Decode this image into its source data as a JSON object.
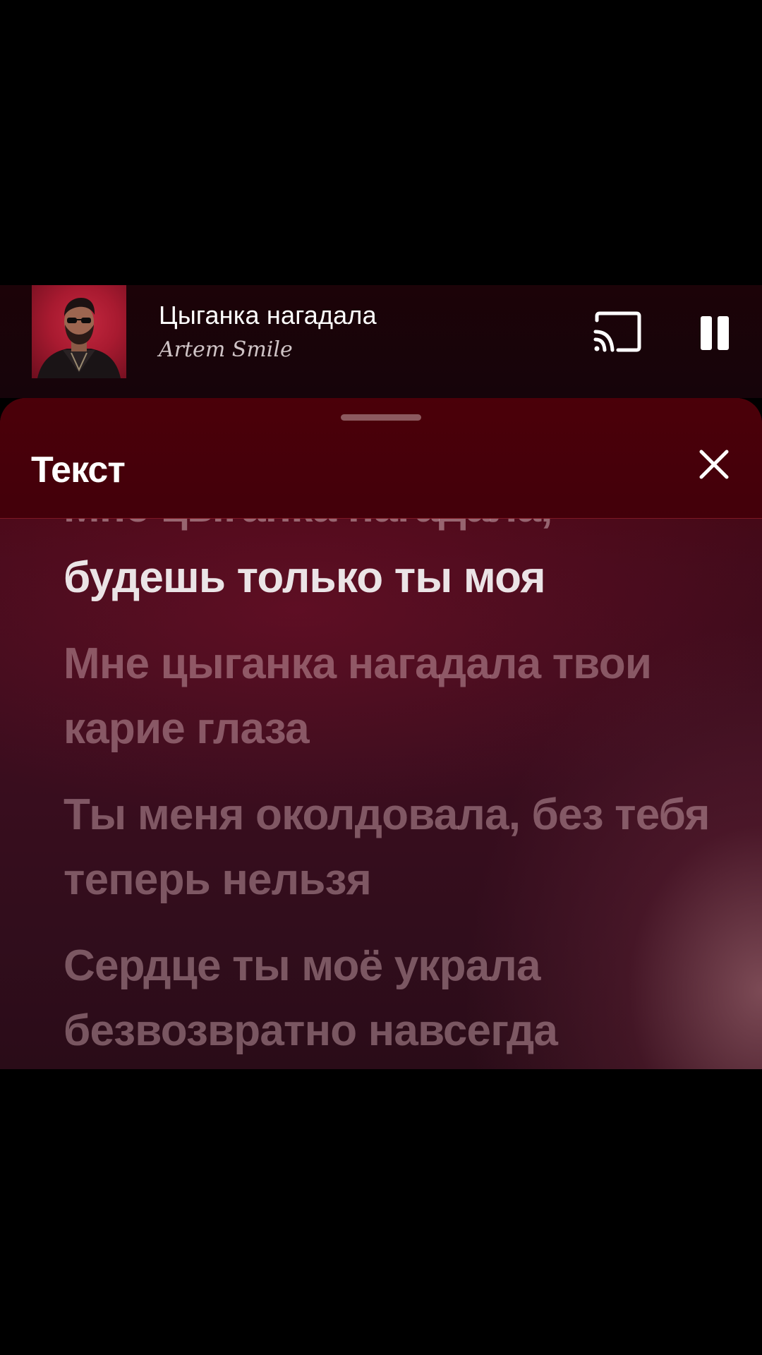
{
  "player": {
    "title": "Цыганка нагадала",
    "artist": "Artem Smile",
    "cover_icon": "album-cover",
    "cast_icon": "cast-icon",
    "pause_icon": "pause-icon"
  },
  "lyrics_panel": {
    "title": "Текст",
    "close_icon": "close-icon",
    "lines": [
      {
        "text": "Мне цыганка нагадала,",
        "state": "past"
      },
      {
        "text": "будешь только ты моя",
        "state": "active"
      },
      {
        "text": "Мне цыганка нагадала твои карие глаза",
        "state": "upcoming"
      },
      {
        "text": "Ты меня околдовала, без тебя теперь нельзя",
        "state": "upcoming"
      },
      {
        "text": "Сердце ты моё украла безвозвратно навсегда",
        "state": "upcoming"
      }
    ]
  },
  "colors": {
    "background": "#000000",
    "sheet_header": "#4b0009",
    "sheet_body": "#3a0d1e",
    "cover_accent": "#b31d33",
    "active_lyric": "#ebe4e6"
  }
}
